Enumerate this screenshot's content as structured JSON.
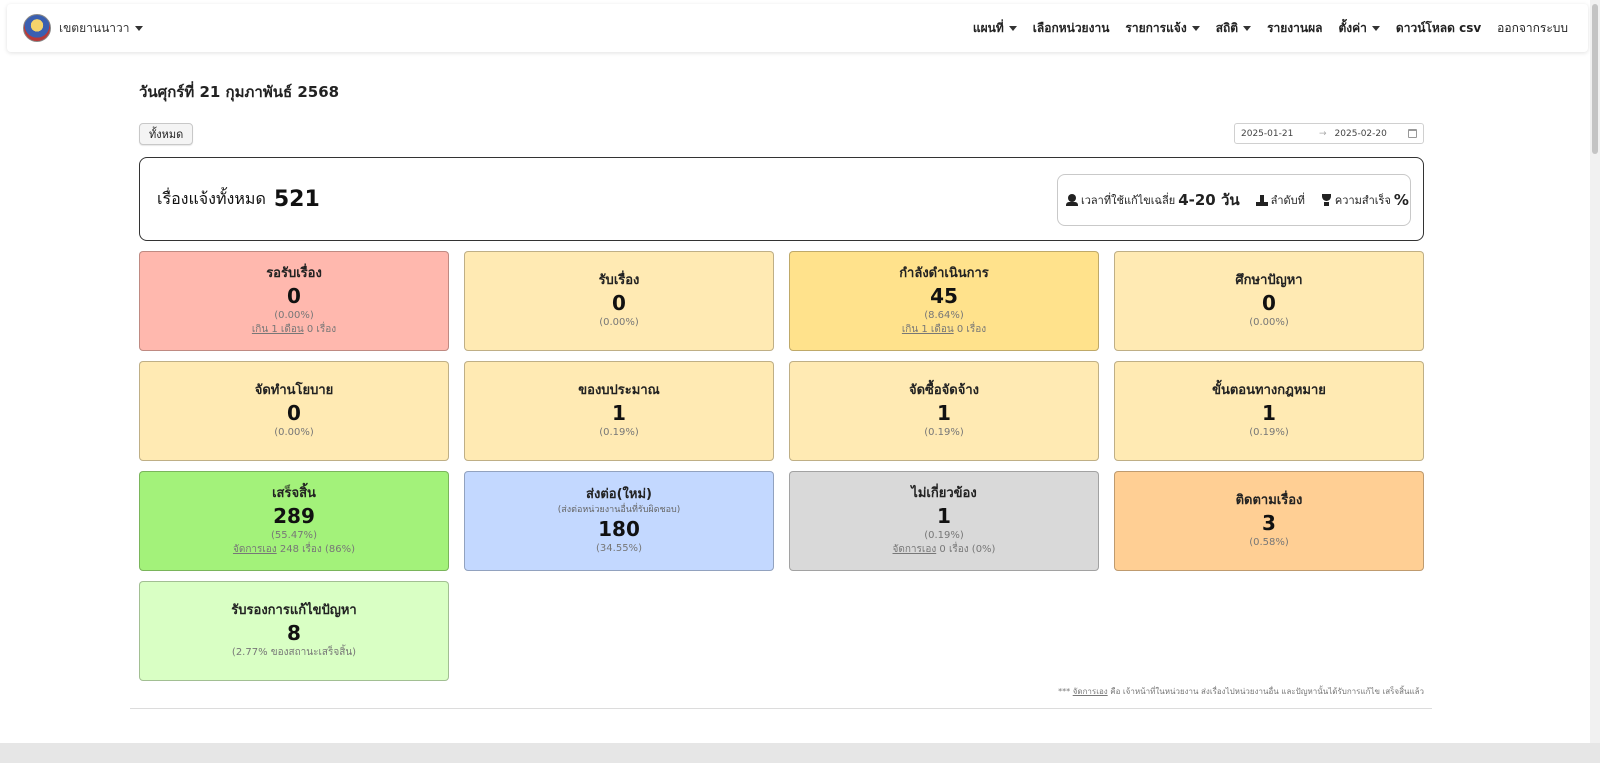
{
  "navbar": {
    "brand": "เขตยานนาวา",
    "items": [
      {
        "label": "แผนที่",
        "dropdown": true
      },
      {
        "label": "เลือกหน่วยงาน",
        "dropdown": false
      },
      {
        "label": "รายการแจ้ง",
        "dropdown": true
      },
      {
        "label": "สถิติ",
        "dropdown": true
      },
      {
        "label": "รายงานผล",
        "dropdown": false
      },
      {
        "label": "ตั้งค่า",
        "dropdown": true
      },
      {
        "label": "ดาวน์โหลด csv",
        "dropdown": false
      },
      {
        "label": "ออกจากระบบ",
        "dropdown": false,
        "plain": true
      }
    ]
  },
  "page": {
    "date_heading": "วันศุกร์ที่ 21 กุมภาพันธ์ 2568",
    "all_button": "ทั้งหมด",
    "range_start": "2025-01-21",
    "range_arrow": "→",
    "range_end": "2025-02-20"
  },
  "summary": {
    "label": "เรื่องแจ้งทั้งหมด",
    "total": "521",
    "avg_time_label": "เวลาที่ใช้แก้ไขเฉลี่ย",
    "avg_time_value": "4-20 วัน",
    "rank_label": "ลำดับที่",
    "success_label": "ความสำเร็จ",
    "success_value": "%"
  },
  "cards": [
    {
      "title": "รอรับเรื่อง",
      "count": "0",
      "pct": "(0.00%)",
      "extra_link": "เกิน 1 เดือน",
      "extra_text": " 0 เรื่อง",
      "bg": "#ffb8ae"
    },
    {
      "title": "รับเรื่อง",
      "count": "0",
      "pct": "(0.00%)",
      "bg": "#ffeab3"
    },
    {
      "title": "กำลังดำเนินการ",
      "count": "45",
      "pct": "(8.64%)",
      "extra_link": "เกิน 1 เดือน",
      "extra_text": " 0 เรื่อง",
      "bg": "#ffe28c"
    },
    {
      "title": "ศึกษาปัญหา",
      "count": "0",
      "pct": "(0.00%)",
      "bg": "#ffeab3"
    },
    {
      "title": "จัดทำนโยบาย",
      "count": "0",
      "pct": "(0.00%)",
      "bg": "#ffeab3"
    },
    {
      "title": "ของบประมาณ",
      "count": "1",
      "pct": "(0.19%)",
      "bg": "#ffeab3"
    },
    {
      "title": "จัดซื้อจัดจ้าง",
      "count": "1",
      "pct": "(0.19%)",
      "bg": "#ffeab3"
    },
    {
      "title": "ขั้นตอนทางกฎหมาย",
      "count": "1",
      "pct": "(0.19%)",
      "bg": "#ffeab3"
    },
    {
      "title": "เสร็จสิ้น",
      "count": "289",
      "pct": "(55.47%)",
      "extra_link": "จัดการเอง",
      "extra_text": " 248 เรื่อง (86%)",
      "bg": "#a3f27a"
    },
    {
      "title": "ส่งต่อ(ใหม่)",
      "sub": "(ส่งต่อหน่วยงานอื่นที่รับผิดชอบ)",
      "count": "180",
      "pct": "(34.55%)",
      "bg": "#c3d8ff"
    },
    {
      "title": "ไม่เกี่ยวข้อง",
      "count": "1",
      "pct": "(0.19%)",
      "extra_link": "จัดการเอง",
      "extra_text": " 0 เรื่อง (0%)",
      "bg": "#d9d9d9"
    },
    {
      "title": "ติดตามเรื่อง",
      "count": "3",
      "pct": "(0.58%)",
      "bg": "#ffcf94"
    },
    {
      "title": "รับรองการแก้ไขปัญหา",
      "count": "8",
      "pct": "(2.77% ของสถานะเสร็จสิ้น)",
      "bg": "#d9ffc4"
    }
  ],
  "footnote": {
    "prefix": "*** ",
    "link": "จัดการเอง",
    "text": " คือ เจ้าหน้าที่ในหน่วยงาน ส่งเรื่องไปหน่วยงานอื่น และปัญหานั้นได้รับการแก้ไข เสร็จสิ้นแล้ว"
  }
}
